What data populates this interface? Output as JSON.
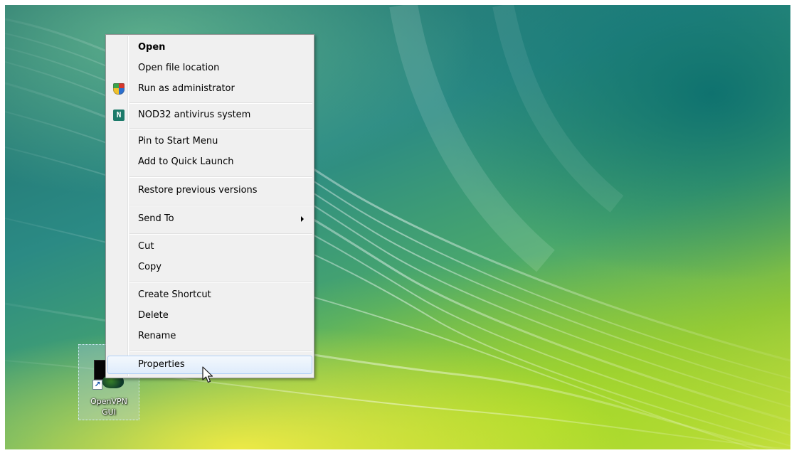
{
  "desktop": {
    "icon": {
      "label_line1": "OpenVPN",
      "label_line2": "GUI",
      "shortcut_glyph": "↗"
    }
  },
  "context_menu": {
    "items": [
      {
        "label": "Open",
        "bold": true
      },
      {
        "label": "Open file location"
      },
      {
        "label": "Run as administrator",
        "icon": "uac-shield-icon"
      },
      {
        "label": "NOD32 antivirus system",
        "icon": "nod32-icon"
      },
      {
        "label": "Pin to Start Menu"
      },
      {
        "label": "Add to Quick Launch"
      },
      {
        "label": "Restore previous versions"
      },
      {
        "label": "Send To",
        "submenu": true
      },
      {
        "label": "Cut"
      },
      {
        "label": "Copy"
      },
      {
        "label": "Create Shortcut"
      },
      {
        "label": "Delete"
      },
      {
        "label": "Rename"
      },
      {
        "label": "Properties",
        "highlighted": true
      }
    ],
    "nod_glyph": "N"
  },
  "colors": {
    "menu_background": "#f0f0f0",
    "highlight_border": "#aecff7"
  }
}
